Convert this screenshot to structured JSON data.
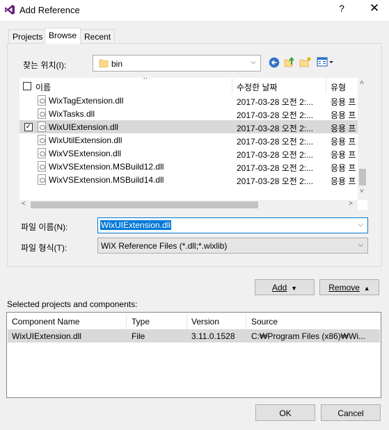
{
  "window": {
    "title": "Add Reference",
    "help": "?",
    "close": "✕"
  },
  "tabs": [
    {
      "label": "Projects"
    },
    {
      "label": "Browse"
    },
    {
      "label": "Recent"
    }
  ],
  "lookin": {
    "label": "찾는 위치(I):",
    "value": "bin"
  },
  "list": {
    "columns": {
      "name": "이름",
      "date": "수정한 날짜",
      "type": "유형"
    },
    "rows": [
      {
        "name": "WixTagExtension.dll",
        "date": "2017-03-28 오전 2:...",
        "type": "응용 프",
        "checked": false,
        "selected": false
      },
      {
        "name": "WixTasks.dll",
        "date": "2017-03-28 오전 2:...",
        "type": "응용 프",
        "checked": false,
        "selected": false
      },
      {
        "name": "WixUIExtension.dll",
        "date": "2017-03-28 오전 2:...",
        "type": "응용 프",
        "checked": true,
        "selected": true
      },
      {
        "name": "WixUtilExtension.dll",
        "date": "2017-03-28 오전 2:...",
        "type": "응용 프",
        "checked": false,
        "selected": false
      },
      {
        "name": "WixVSExtension.dll",
        "date": "2017-03-28 오전 2:...",
        "type": "응용 프",
        "checked": false,
        "selected": false
      },
      {
        "name": "WixVSExtension.MSBuild12.dll",
        "date": "2017-03-28 오전 2:...",
        "type": "응용 프",
        "checked": false,
        "selected": false
      },
      {
        "name": "WixVSExtension.MSBuild14.dll",
        "date": "2017-03-28 오전 2:...",
        "type": "응용 프",
        "checked": false,
        "selected": false
      }
    ]
  },
  "filename": {
    "label": "파일 이름(N):",
    "value": "WixUIExtension.dll"
  },
  "filetype": {
    "label": "파일 형식(T):",
    "value": "WiX Reference Files (*.dll;*.wixlib)"
  },
  "buttons": {
    "add": "Add",
    "remove": "Remove",
    "ok": "OK",
    "cancel": "Cancel"
  },
  "selected": {
    "label": "Selected projects and components:",
    "columns": {
      "component": "Component Name",
      "type": "Type",
      "version": "Version",
      "source": "Source"
    },
    "rows": [
      {
        "component": "WixUIExtension.dll",
        "type": "File",
        "version": "3.11.0.1528",
        "source": "C:₩Program Files (x86)₩Wi..."
      }
    ]
  },
  "colors": {
    "accent": "#0078d7",
    "selected_row": "#d9d9d9",
    "vs_purple": "#68217a"
  }
}
